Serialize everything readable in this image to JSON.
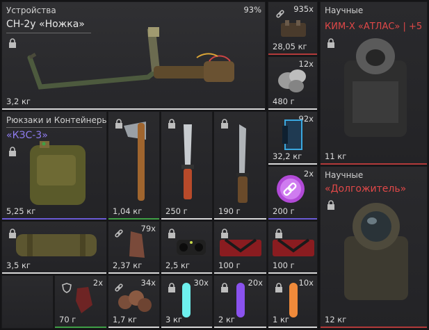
{
  "devices": {
    "category": "Устройства",
    "percent": "93%",
    "item_name": "СН-2у «Ножка»",
    "weight": "3,2 кг",
    "icon": "lock-icon"
  },
  "backpacks": {
    "category": "Рюкзаки и Контейнеры",
    "item_name": "«КЗС-3»",
    "weight": "5,25 кг",
    "icon": "lock-icon"
  },
  "scientific_1": {
    "category": "Научные",
    "item_name": "КИМ-Х «АТЛАС» | +5",
    "weight": "11 кг",
    "icon": "lock-icon"
  },
  "scientific_2": {
    "category": "Научные",
    "item_name": "«Долгожитель»",
    "weight": "12 кг",
    "icon": "lock-icon"
  },
  "middle_column": [
    {
      "count": "935x",
      "weight": "28,05 кг",
      "icon": "link-icon"
    },
    {
      "count": "12x",
      "weight": "480 г",
      "icon": "ore-icon"
    },
    {
      "count": "92x",
      "weight": "32,2 кг",
      "icon": "battery-icon"
    },
    {
      "count": "2x",
      "weight": "200 г",
      "icon": "link-badge-icon"
    }
  ],
  "row2": [
    {
      "weight": "1,04 кг",
      "icon": "lock-icon"
    },
    {
      "weight": "250 г",
      "icon": "lock-icon"
    },
    {
      "weight": "190 г",
      "icon": "lock-icon"
    }
  ],
  "row3": [
    {
      "weight": "3,5 кг",
      "icon": "lock-icon"
    },
    {
      "count": "79x",
      "weight": "2,37 кг",
      "icon": "link-icon"
    },
    {
      "weight": "2,5 кг",
      "icon": "lock-icon"
    },
    {
      "weight": "100 г",
      "icon": "lock-icon"
    },
    {
      "weight": "100 г",
      "icon": "lock-icon"
    }
  ],
  "row4": [
    {
      "count": "2x",
      "weight": "70 г",
      "icon": "shield-icon"
    },
    {
      "count": "34x",
      "weight": "1,7 кг",
      "icon": "link-icon"
    },
    {
      "count": "30x",
      "weight": "3 кг",
      "icon": "lock-icon"
    },
    {
      "count": "20x",
      "weight": "2 кг",
      "icon": "lock-icon"
    },
    {
      "count": "10x",
      "weight": "1 кг",
      "icon": "lock-icon"
    }
  ],
  "colors": {
    "green_bar": "#3fa046",
    "purple_bar": "#6b5bd6",
    "red_bar": "#b33a3a",
    "white_bar": "#d8d8d8",
    "name_red": "#e04848",
    "name_purple": "#8f7cf0"
  }
}
